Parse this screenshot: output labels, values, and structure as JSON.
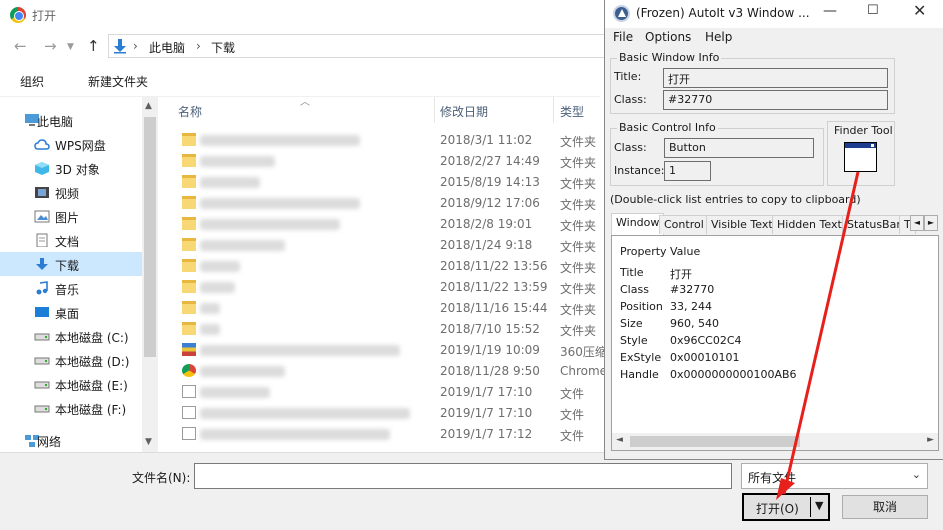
{
  "dialog": {
    "title": "打开",
    "breadcrumb": [
      "此电脑",
      "下载"
    ],
    "toolbar": {
      "organize": "组织",
      "new_folder": "新建文件夹"
    },
    "tree": [
      {
        "label": "此电脑",
        "icon": "computer-icon"
      },
      {
        "label": "WPS网盘",
        "icon": "cloud-icon"
      },
      {
        "label": "3D 对象",
        "icon": "cube-icon"
      },
      {
        "label": "视频",
        "icon": "video-icon"
      },
      {
        "label": "图片",
        "icon": "picture-icon"
      },
      {
        "label": "文档",
        "icon": "document-icon"
      },
      {
        "label": "下载",
        "icon": "download-icon",
        "selected": true
      },
      {
        "label": "音乐",
        "icon": "music-icon"
      },
      {
        "label": "桌面",
        "icon": "desktop-icon"
      },
      {
        "label": "本地磁盘 (C:)",
        "icon": "drive-icon"
      },
      {
        "label": "本地磁盘 (D:)",
        "icon": "drive-icon"
      },
      {
        "label": "本地磁盘 (E:)",
        "icon": "drive-icon"
      },
      {
        "label": "本地磁盘 (F:)",
        "icon": "drive-icon"
      },
      {
        "label": "网络",
        "icon": "network-icon"
      }
    ],
    "columns": {
      "name": "名称",
      "date": "修改日期",
      "type": "类型"
    },
    "files": [
      {
        "icon": "folder",
        "date": "2018/3/1 11:02",
        "type": "文件夹",
        "blur": 160
      },
      {
        "icon": "folder",
        "date": "2018/2/27 14:49",
        "type": "文件夹",
        "blur": 75
      },
      {
        "icon": "folder",
        "date": "2015/8/19 14:13",
        "type": "文件夹",
        "blur": 60
      },
      {
        "icon": "folder",
        "date": "2018/9/12 17:06",
        "type": "文件夹",
        "blur": 160
      },
      {
        "icon": "folder",
        "date": "2018/2/8 19:01",
        "type": "文件夹",
        "blur": 140
      },
      {
        "icon": "folder",
        "date": "2018/1/24 9:18",
        "type": "文件夹",
        "blur": 85
      },
      {
        "icon": "folder",
        "date": "2018/11/22 13:56",
        "type": "文件夹",
        "blur": 40
      },
      {
        "icon": "folder",
        "date": "2018/11/22 13:59",
        "type": "文件夹",
        "blur": 35
      },
      {
        "icon": "folder",
        "date": "2018/11/16 15:44",
        "type": "文件夹",
        "blur": 20
      },
      {
        "icon": "folder",
        "date": "2018/7/10 15:52",
        "type": "文件夹",
        "blur": 20
      },
      {
        "icon": "archive",
        "date": "2019/1/19 10:09",
        "type": "360压缩",
        "blur": 200
      },
      {
        "icon": "chrome",
        "date": "2018/11/28 9:50",
        "type": "Chrome",
        "blur": 85
      },
      {
        "icon": "doc",
        "date": "2019/1/7 17:10",
        "type": "文件",
        "blur": 70
      },
      {
        "icon": "doc",
        "date": "2019/1/7 17:10",
        "type": "文件",
        "blur": 210
      },
      {
        "icon": "doc",
        "date": "2019/1/7 17:12",
        "type": "文件",
        "blur": 190
      }
    ],
    "filename_label": "文件名(N):",
    "filename_value": "",
    "filter_label": "所有文件",
    "open_button": "打开(O)",
    "cancel_button": "取消"
  },
  "autoit": {
    "title": "(Frozen) AutoIt v3 Window ...",
    "menu": [
      "File",
      "Options",
      "Help"
    ],
    "basic_window": {
      "group": "Basic Window Info",
      "title_label": "Title:",
      "title_value": "打开",
      "class_label": "Class:",
      "class_value": "#32770"
    },
    "basic_control": {
      "group": "Basic Control Info",
      "class_label": "Class:",
      "class_value": "Button",
      "instance_label": "Instance:",
      "instance_value": "1"
    },
    "finder_tool": "Finder Tool",
    "hint": "(Double-click list entries to copy to clipboard)",
    "tabs": [
      "Window",
      "Control",
      "Visible Text",
      "Hidden Text",
      "StatusBar",
      "T"
    ],
    "props_header": {
      "property": "Property",
      "value": "Value"
    },
    "props": [
      {
        "name": "Title",
        "value": "打开"
      },
      {
        "name": "Class",
        "value": "#32770"
      },
      {
        "name": "Position",
        "value": "33, 244"
      },
      {
        "name": "Size",
        "value": "960, 540"
      },
      {
        "name": "Style",
        "value": "0x96CC02C4"
      },
      {
        "name": "ExStyle",
        "value": "0x00010101"
      },
      {
        "name": "Handle",
        "value": "0x0000000000100AB6"
      }
    ]
  }
}
